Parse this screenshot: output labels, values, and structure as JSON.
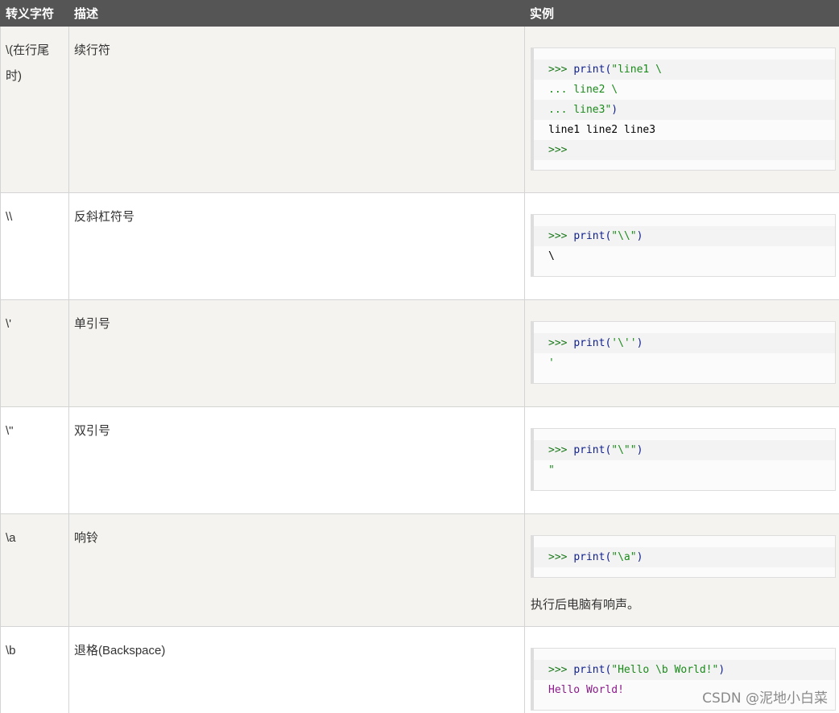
{
  "headers": [
    "转义字符",
    "描述",
    "实例"
  ],
  "rows": [
    {
      "char": "\\(在行尾时)",
      "desc": "续行符",
      "code": [
        [
          {
            "t": ">>> ",
            "c": "prompt"
          },
          {
            "t": "print(",
            "c": "func"
          },
          {
            "t": "\"line1 \\",
            "c": "str"
          }
        ],
        [
          {
            "t": "... line2 \\",
            "c": "str"
          }
        ],
        [
          {
            "t": "... line3\"",
            "c": "str"
          },
          {
            "t": ")",
            "c": "func"
          }
        ],
        [
          {
            "t": "line1 line2 line3",
            "c": "out"
          }
        ],
        [
          {
            "t": ">>>",
            "c": "prompt"
          }
        ]
      ],
      "note": ""
    },
    {
      "char": "\\\\",
      "desc": "反斜杠符号",
      "code": [
        [
          {
            "t": ">>> ",
            "c": "prompt"
          },
          {
            "t": "print(",
            "c": "func"
          },
          {
            "t": "\"\\\\\"",
            "c": "str"
          },
          {
            "t": ")",
            "c": "func"
          }
        ],
        [
          {
            "t": "\\",
            "c": "out"
          }
        ]
      ],
      "note": ""
    },
    {
      "char": "\\'",
      "desc": "单引号",
      "code": [
        [
          {
            "t": ">>> ",
            "c": "prompt"
          },
          {
            "t": "print(",
            "c": "func"
          },
          {
            "t": "'\\''",
            "c": "str"
          },
          {
            "t": ")",
            "c": "func"
          }
        ],
        [
          {
            "t": "'",
            "c": "str"
          }
        ]
      ],
      "note": ""
    },
    {
      "char": "\\\"",
      "desc": "双引号",
      "code": [
        [
          {
            "t": ">>> ",
            "c": "prompt"
          },
          {
            "t": "print(",
            "c": "func"
          },
          {
            "t": "\"\\\"\"",
            "c": "str"
          },
          {
            "t": ")",
            "c": "func"
          }
        ],
        [
          {
            "t": "\"",
            "c": "str"
          }
        ]
      ],
      "note": ""
    },
    {
      "char": "\\a",
      "desc": "响铃",
      "code": [
        [
          {
            "t": ">>> ",
            "c": "prompt"
          },
          {
            "t": "print(",
            "c": "func"
          },
          {
            "t": "\"\\a\"",
            "c": "str"
          },
          {
            "t": ")",
            "c": "func"
          }
        ]
      ],
      "note": "执行后电脑有响声。"
    },
    {
      "char": "\\b",
      "desc": "退格(Backspace)",
      "code": [
        [
          {
            "t": ">>> ",
            "c": "prompt"
          },
          {
            "t": "print(",
            "c": "func"
          },
          {
            "t": "\"Hello \\b World!\"",
            "c": "str"
          },
          {
            "t": ")",
            "c": "func"
          }
        ],
        [
          {
            "t": "Hello World!",
            "c": "mag"
          }
        ]
      ],
      "note": ""
    }
  ],
  "watermark": "CSDN @泥地小白菜"
}
